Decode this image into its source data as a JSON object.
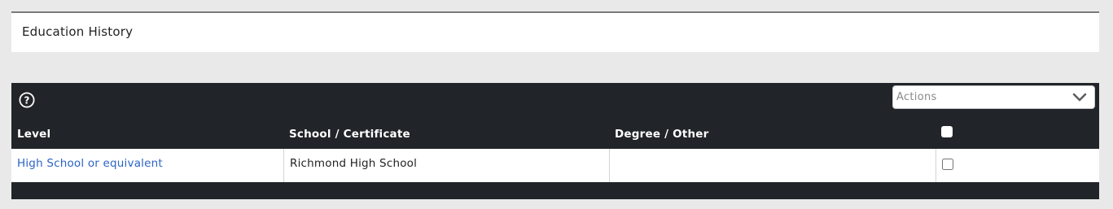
{
  "section": {
    "title": "Education History"
  },
  "panel": {
    "help_icon": "question-circle-icon",
    "actions": {
      "selected": "Actions",
      "icon": "chevron-down-icon"
    }
  },
  "table": {
    "columns": [
      "Level",
      "School / Certificate",
      "Degree / Other"
    ],
    "rows": [
      {
        "level": "High School or equivalent",
        "school": "Richmond High School",
        "degree": "",
        "checked": false
      }
    ]
  },
  "colors": {
    "page_background": "#e9e9e9",
    "panel_background": "#212428",
    "link": "#2b63c7",
    "text": "#222222"
  }
}
